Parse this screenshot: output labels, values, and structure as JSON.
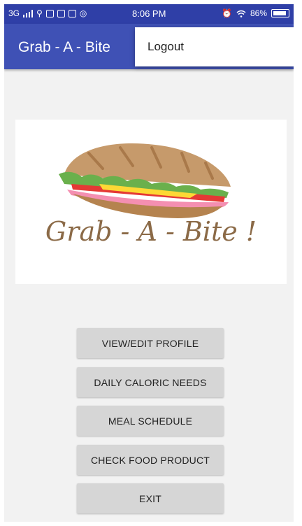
{
  "status_bar": {
    "network": "3G",
    "time": "8:06 PM",
    "battery_percent": "86%"
  },
  "app_bar": {
    "title": "Grab - A - Bite"
  },
  "overflow_menu": {
    "items": [
      "Logout"
    ]
  },
  "logo": {
    "text": "Grab - A - Bite !",
    "icon": "sandwich-icon"
  },
  "menu_buttons": [
    "VIEW/EDIT PROFILE",
    "DAILY CALORIC NEEDS",
    "MEAL SCHEDULE",
    "CHECK FOOD PRODUCT",
    "EXIT"
  ],
  "colors": {
    "primary": "#3f51b5",
    "status_bar": "#2f3fa7",
    "background": "#f2f2f2",
    "button": "#d6d6d6",
    "logo_text": "#8b6a47"
  }
}
